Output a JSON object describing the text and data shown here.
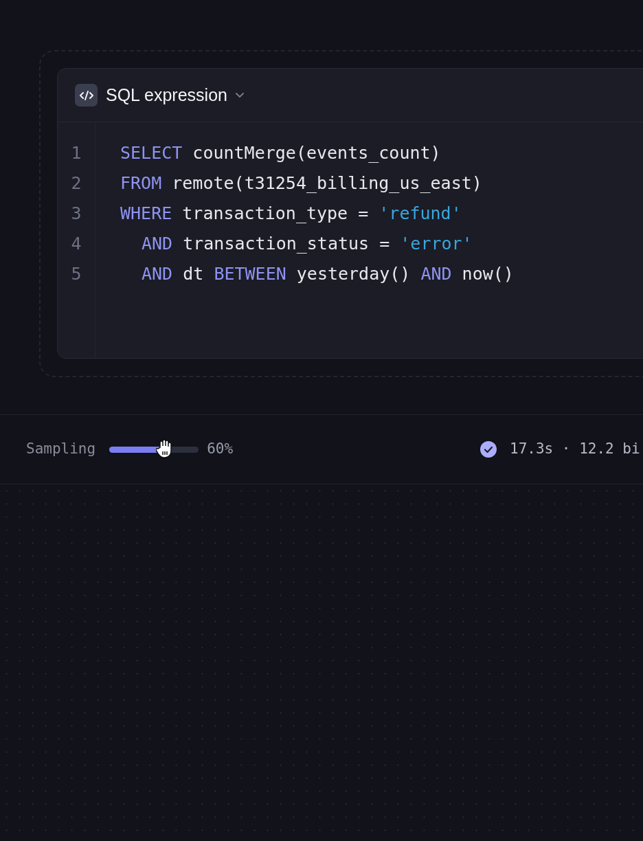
{
  "editor": {
    "title": "SQL expression",
    "lines": [
      {
        "number": "1",
        "indent": false,
        "tokens": [
          {
            "kind": "keyword",
            "text": "SELECT"
          },
          {
            "kind": "plain",
            "text": " countMerge(events_count)"
          }
        ]
      },
      {
        "number": "2",
        "indent": false,
        "tokens": [
          {
            "kind": "keyword",
            "text": "FROM"
          },
          {
            "kind": "plain",
            "text": " remote(t31254_billing_us_east)"
          }
        ]
      },
      {
        "number": "3",
        "indent": false,
        "tokens": [
          {
            "kind": "keyword",
            "text": "WHERE"
          },
          {
            "kind": "plain",
            "text": " transaction_type = "
          },
          {
            "kind": "string",
            "text": "'refund'"
          }
        ]
      },
      {
        "number": "4",
        "indent": true,
        "tokens": [
          {
            "kind": "keyword",
            "text": "AND"
          },
          {
            "kind": "plain",
            "text": " transaction_status = "
          },
          {
            "kind": "string",
            "text": "'error'"
          }
        ]
      },
      {
        "number": "5",
        "indent": true,
        "tokens": [
          {
            "kind": "keyword",
            "text": "AND"
          },
          {
            "kind": "plain",
            "text": " dt "
          },
          {
            "kind": "keyword",
            "text": "BETWEEN"
          },
          {
            "kind": "plain",
            "text": " yesterday() "
          },
          {
            "kind": "keyword",
            "text": "AND"
          },
          {
            "kind": "plain",
            "text": " now()"
          }
        ]
      }
    ]
  },
  "status_bar": {
    "sampling": {
      "label": "Sampling",
      "level": 0.6,
      "reading": "60%"
    },
    "result": {
      "ok": true,
      "text": "17.3s · 12.2 bi"
    }
  }
}
